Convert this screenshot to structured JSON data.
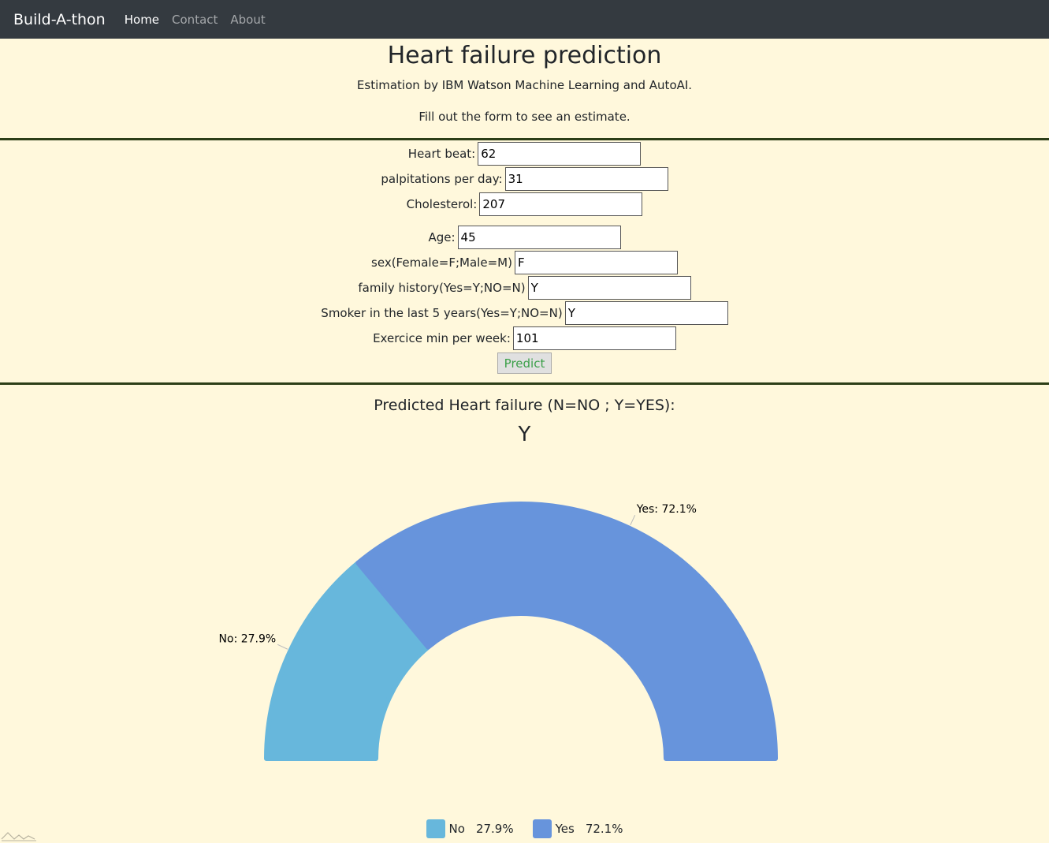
{
  "nav": {
    "brand": "Build-A-thon",
    "links": [
      {
        "label": "Home",
        "active": true
      },
      {
        "label": "Contact",
        "active": false
      },
      {
        "label": "About",
        "active": false
      }
    ]
  },
  "header": {
    "title": "Heart failure prediction",
    "subtitle": "Estimation by IBM Watson Machine Learning and AutoAI.",
    "instruction": "Fill out the form to see an estimate."
  },
  "form": {
    "fields": [
      {
        "label": "Heart beat:",
        "value": "62"
      },
      {
        "label": "palpitations per day:",
        "value": "31"
      },
      {
        "label": "Cholesterol:",
        "value": "207"
      },
      {
        "label": "Age:",
        "value": "45"
      },
      {
        "label": "sex(Female=F;Male=M)",
        "value": "F"
      },
      {
        "label": "family history(Yes=Y;NO=N)",
        "value": "Y"
      },
      {
        "label": "Smoker in the last 5 years(Yes=Y;NO=N)",
        "value": "Y"
      },
      {
        "label": "Exercice min per week:",
        "value": "101"
      }
    ],
    "submit_label": "Predict"
  },
  "result": {
    "label": "Predicted Heart failure (N=NO ; Y=YES):",
    "value": "Y"
  },
  "chart_data": {
    "type": "pie",
    "subtype": "half-donut",
    "categories": [
      "No",
      "Yes"
    ],
    "values": [
      27.9,
      72.1
    ],
    "unit": "%",
    "slice_labels": [
      "No: 27.9%",
      "Yes: 72.1%"
    ],
    "legend": [
      {
        "name": "No",
        "value": "27.9%"
      },
      {
        "name": "Yes",
        "value": "72.1%"
      }
    ],
    "colors": [
      "#67b7dc",
      "#6794dc"
    ],
    "legend_position": "bottom"
  }
}
